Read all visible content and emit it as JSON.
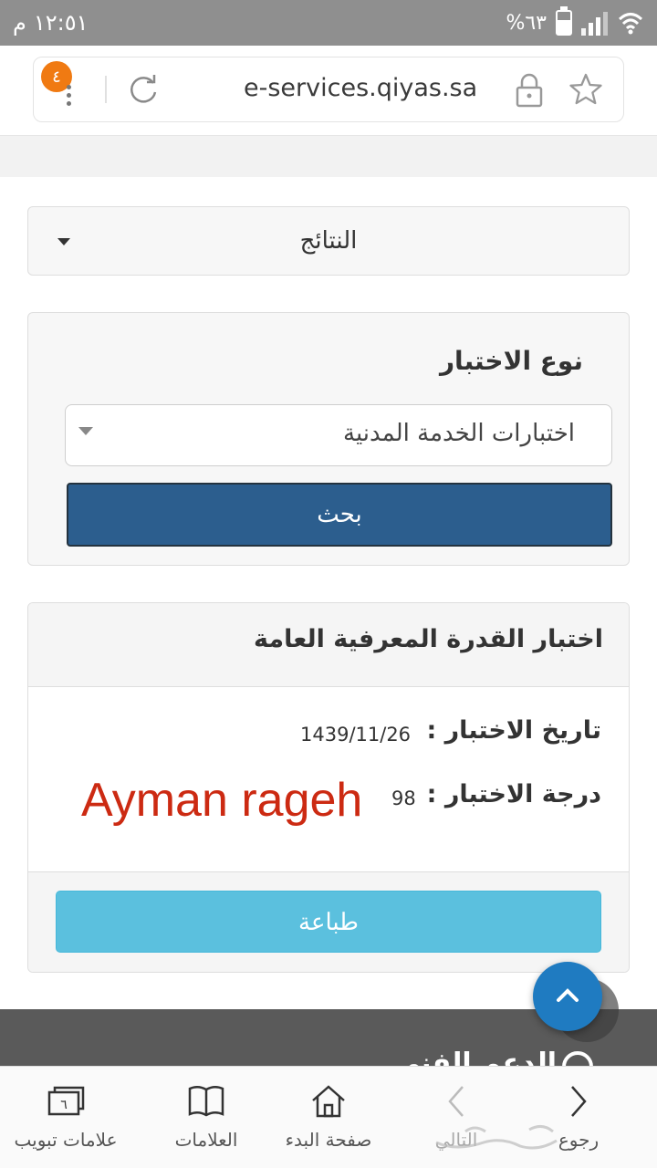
{
  "status_bar": {
    "time": "١٢:٥١",
    "time_suffix": "م",
    "battery": "%٦٣"
  },
  "browser": {
    "url": "e-services.qiyas.sa",
    "tab_count": "٤"
  },
  "results_dropdown": {
    "label": "النتائج"
  },
  "test_type_panel": {
    "title": "نوع الاختبار",
    "selected_option": "اختبارات الخدمة المدنية",
    "search_button": "بحث"
  },
  "result_card": {
    "title": "اختبار القدرة المعرفية العامة",
    "date_label": "تاريخ الاختبار :",
    "date_value": "1439/11/26",
    "score_label": "درجة الاختبار :",
    "score_value": "98",
    "overlay_name": "Ayman rageh",
    "print_button": "طباعة"
  },
  "site_footer": {
    "support_text": "الدعم الفني"
  },
  "bottom_toolbar": {
    "back_label": "رجوع",
    "forward_label": "التالي",
    "home_label": "صفحة البدء",
    "bookmarks_label": "العلامات",
    "tabs_label": "علامات تبويب",
    "tabs_count": "٦"
  },
  "colors": {
    "search_button": "#2c5e8e",
    "print_button": "#5bc0de",
    "fab": "#1f7bc1",
    "tab_badge": "#f07a12",
    "overlay_name": "#cc2a12"
  }
}
